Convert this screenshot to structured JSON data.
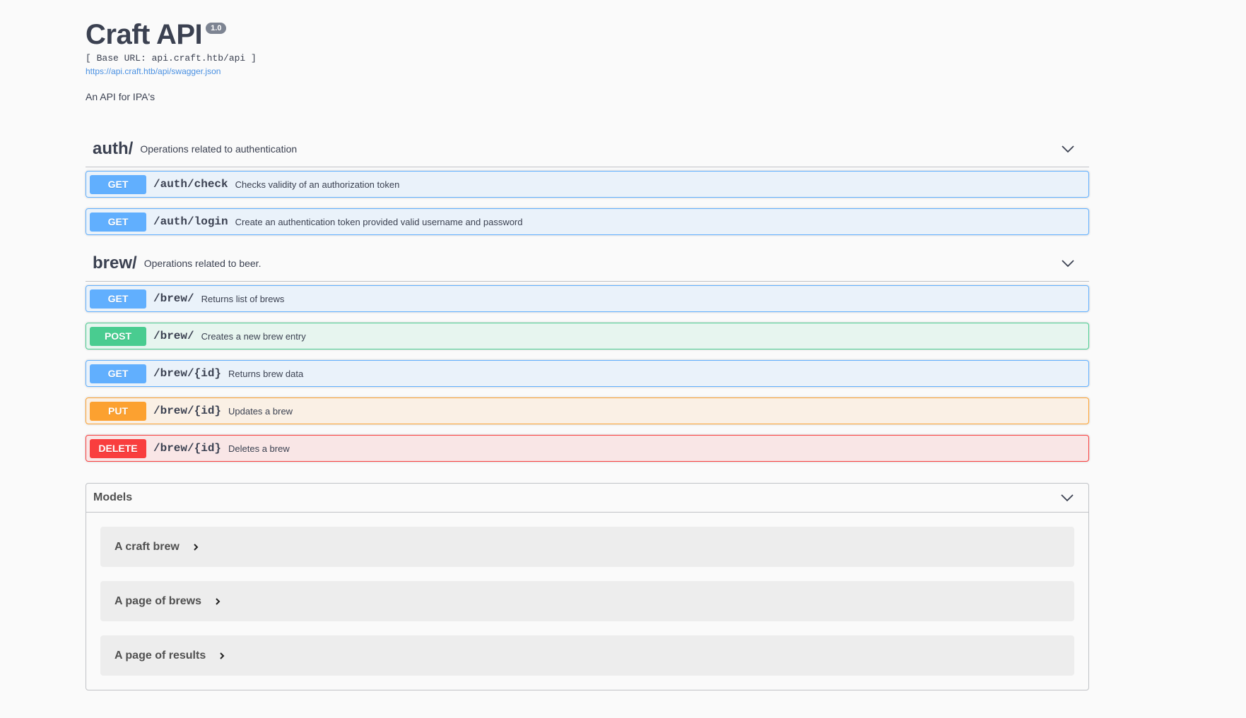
{
  "info": {
    "title": "Craft API",
    "version": "1.0",
    "base_url": "[ Base URL: api.craft.htb/api ]",
    "spec_link": "https://api.craft.htb/api/swagger.json",
    "description": "An API for IPA's"
  },
  "tags": [
    {
      "name": "auth/",
      "description": "Operations related to authentication",
      "icon": "chevron-down-icon",
      "operations": [
        {
          "method": "GET",
          "path": "/auth/check",
          "summary": "Checks validity of an authorization token"
        },
        {
          "method": "GET",
          "path": "/auth/login",
          "summary": "Create an authentication token provided valid username and password"
        }
      ]
    },
    {
      "name": "brew/",
      "description": "Operations related to beer.",
      "icon": "chevron-down-icon",
      "operations": [
        {
          "method": "GET",
          "path": "/brew/",
          "summary": "Returns list of brews"
        },
        {
          "method": "POST",
          "path": "/brew/",
          "summary": "Creates a new brew entry"
        },
        {
          "method": "GET",
          "path": "/brew/{id}",
          "summary": "Returns brew data"
        },
        {
          "method": "PUT",
          "path": "/brew/{id}",
          "summary": "Updates a brew"
        },
        {
          "method": "DELETE",
          "path": "/brew/{id}",
          "summary": "Deletes a brew"
        }
      ]
    }
  ],
  "models": {
    "title": "Models",
    "icon": "chevron-down-icon",
    "items": [
      {
        "name": "A craft brew",
        "icon": "chevron-right-icon"
      },
      {
        "name": "A page of brews",
        "icon": "chevron-right-icon"
      },
      {
        "name": "A page of results",
        "icon": "chevron-right-icon"
      }
    ]
  },
  "colors": {
    "get": "#61affe",
    "post": "#49cc90",
    "put": "#fca130",
    "delete": "#f93e3e",
    "link": "#4990e2",
    "text": "#3b4151"
  }
}
